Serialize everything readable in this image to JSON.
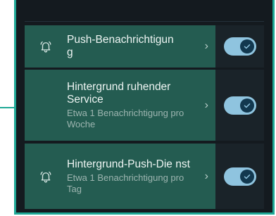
{
  "settings": {
    "rows": [
      {
        "title": "Push-Benachrichtigun\ng",
        "subtitle": "",
        "icon": "bell-icon",
        "enabled": true
      },
      {
        "title": "Hintergrund ruhender Service",
        "subtitle": "Etwa 1 Benachrichtigung pro Woche",
        "icon": "",
        "enabled": true
      },
      {
        "title": "Hintergrund-Push-Die nst",
        "subtitle": "Etwa 1 Benachrichtigung pro Tag",
        "icon": "bell-icon",
        "enabled": true
      }
    ]
  },
  "colors": {
    "accent": "#1fa896",
    "highlight": "#245c51",
    "toggle_track": "#8fc4df",
    "toggle_knob": "#12384f"
  }
}
